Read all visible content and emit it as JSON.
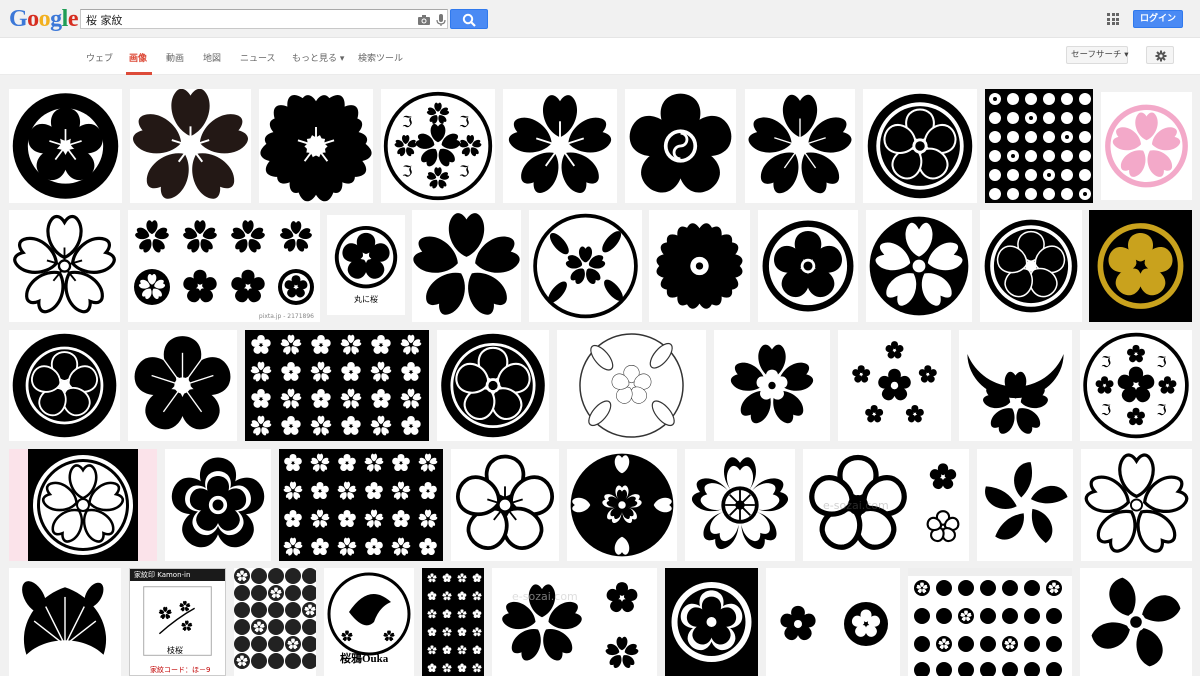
{
  "logo": {
    "letters": [
      "G",
      "o",
      "o",
      "g",
      "l",
      "e"
    ],
    "colors": [
      "#3c78d8",
      "#d62d20",
      "#f2b01e",
      "#3c78d8",
      "#1f9d55",
      "#d62d20"
    ]
  },
  "search": {
    "query": "桜 家紋"
  },
  "header": {
    "login_label": "ログイン"
  },
  "nav": {
    "items": [
      {
        "label": "ウェブ",
        "active": false
      },
      {
        "label": "画像",
        "active": true
      },
      {
        "label": "動画",
        "active": false
      },
      {
        "label": "地図",
        "active": false
      },
      {
        "label": "ニュース",
        "active": false
      },
      {
        "label": "もっと見る ▾",
        "active": false
      },
      {
        "label": "検索ツール",
        "active": false
      }
    ],
    "safe_search_label": "セーフサーチ ▾"
  },
  "results": {
    "captions": {
      "pixta": "pixta.jp - 2171896",
      "maru": "丸に桜",
      "shokubutsu": "枝桜",
      "kamon_code": "家紋コード：ほ－9",
      "kamonin": "家紋印 Kamon-in",
      "ouka": "桜鴉Ouka",
      "esozai": "e-sozai.com"
    }
  },
  "colors": {
    "accent": "#4a8af4",
    "active_tab": "#dd4b39",
    "pink_crest": "#f3a9c9",
    "gold": "#c9a21d"
  }
}
